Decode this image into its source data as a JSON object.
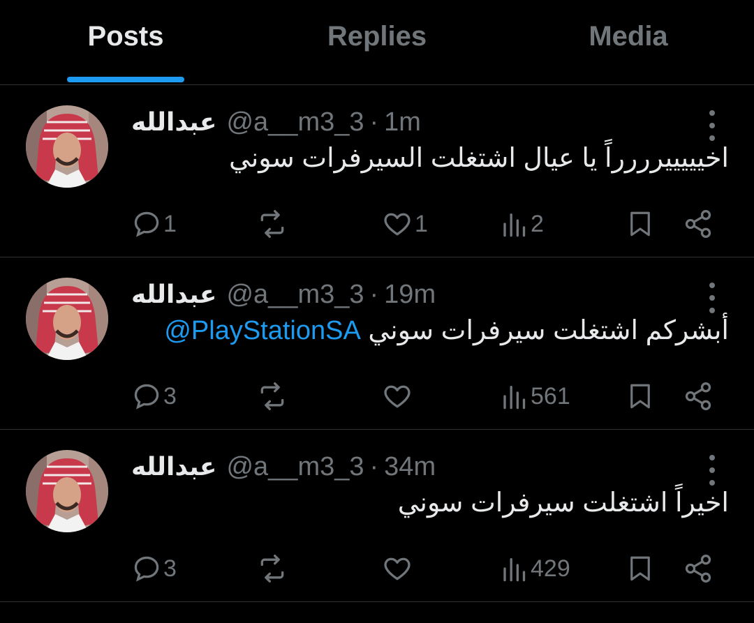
{
  "tabs": [
    {
      "label": "Posts",
      "active": true
    },
    {
      "label": "Replies",
      "active": false
    },
    {
      "label": "Media",
      "active": false
    }
  ],
  "colors": {
    "accent": "#1d9bf0",
    "muted": "#71767b",
    "text": "#e7e9ea",
    "background": "#000000",
    "divider": "#2f3336"
  },
  "posts": [
    {
      "name": "عبدالله",
      "handle": "@a__m3_3",
      "separator": "·",
      "time": "1m",
      "text": "اخيييييرررراً يا عيال اشتغلت السيرفرات سوني",
      "mention": "",
      "replies": "1",
      "reposts": "",
      "likes": "1",
      "views": "2"
    },
    {
      "name": "عبدالله",
      "handle": "@a__m3_3",
      "separator": "·",
      "time": "19m",
      "text": "أبشركم اشتغلت سيرفرات سوني",
      "mention": "@PlayStationSA",
      "replies": "3",
      "reposts": "",
      "likes": "",
      "views": "561"
    },
    {
      "name": "عبدالله",
      "handle": "@a__m3_3",
      "separator": "·",
      "time": "34m",
      "text": "اخيراً اشتغلت سيرفرات سوني",
      "mention": "",
      "replies": "3",
      "reposts": "",
      "likes": "",
      "views": "429"
    }
  ]
}
